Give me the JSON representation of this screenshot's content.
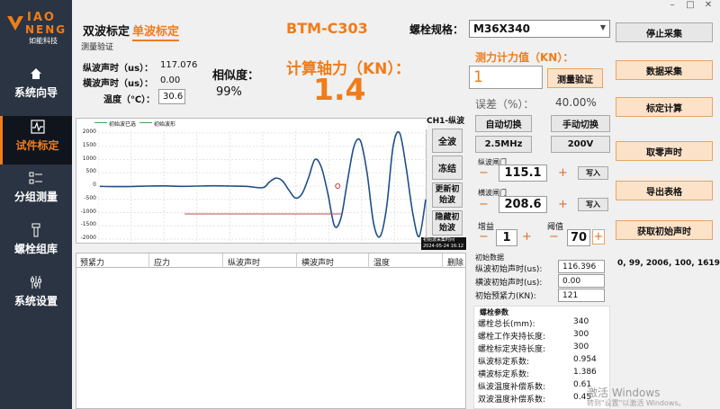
{
  "logo": {
    "line1": "IAO",
    "line2": "NENG",
    "subtitle": "如能科技"
  },
  "nav": [
    {
      "label": "系统向导",
      "icon": "home-icon"
    },
    {
      "label": "试件标定",
      "icon": "waveform-icon",
      "active": true
    },
    {
      "label": "分组测量",
      "icon": "list-icon"
    },
    {
      "label": "螺栓组库",
      "icon": "bolt-icon"
    },
    {
      "label": "系统设置",
      "icon": "settings-icon"
    }
  ],
  "header": {
    "tab_dual": "双波标定",
    "tab_single": "单波标定",
    "device": "BTM-C303",
    "spec_label": "螺栓规格：",
    "spec_value": "M36X340"
  },
  "measure": {
    "section_label": "测量验证",
    "long_label": "纵波声时（us）：",
    "long_value": "117.076",
    "trans_label": "横波声时（us）：",
    "trans_value": "0.00",
    "temp_label": "温度（℃）：",
    "temp_value": "30.6",
    "similarity_label": "相似度：",
    "similarity_value": "99%",
    "axial_label": "计算轴力（KN）：",
    "axial_value": "1.4",
    "force_label": "测力计力值（KN）：",
    "force_value": "1",
    "verify_btn": "测量验证",
    "error_label": "误差（%）：",
    "error_value": "40.00%"
  },
  "chart": {
    "legend_series1": "初始波已选",
    "legend_series2": "初始波形",
    "channel": "CH1-纵波",
    "btn_full": "全波",
    "btn_freeze": "冻结",
    "btn_update": "更新初始波",
    "btn_hide": "隐藏初始波",
    "status_strip": "初始波采集时间",
    "status_date": "2024-05-24 16:12",
    "yticks": [
      "2000",
      "1500",
      "1000",
      "500",
      "0",
      "-500",
      "-1000",
      "-1500",
      "-2000"
    ]
  },
  "chart_data": {
    "type": "line",
    "series": [
      {
        "name": "初始波形"
      }
    ],
    "ylim": [
      -2000,
      2000
    ],
    "yticks": [
      2000,
      1500,
      1000,
      500,
      0,
      -500,
      -1000,
      -1500,
      -2000
    ],
    "x": [
      0,
      0.05,
      0.1,
      0.15,
      0.2,
      0.25,
      0.3,
      0.35,
      0.4,
      0.45,
      0.5,
      0.52,
      0.54,
      0.56,
      0.58,
      0.6,
      0.62,
      0.64,
      0.66,
      0.68,
      0.7,
      0.72,
      0.74,
      0.76,
      0.78,
      0.8,
      0.82,
      0.84,
      0.86,
      0.88,
      0.9,
      0.92,
      0.94,
      0.96,
      0.98,
      1.0
    ],
    "y": [
      -10,
      -20,
      -15,
      0,
      5,
      -10,
      0,
      10,
      0,
      -10,
      -60,
      150,
      300,
      200,
      -150,
      -450,
      -300,
      300,
      1000,
      700,
      -300,
      -1500,
      -1200,
      200,
      1500,
      1700,
      500,
      -1400,
      -1900,
      -800,
      1500,
      2000,
      700,
      -1000,
      -1900,
      -500
    ],
    "marker_x": 0.73,
    "marker_y": 0,
    "hline_y": -1050,
    "hline_x": [
      0.26,
      0.74
    ]
  },
  "controls": {
    "auto_switch": "自动切换",
    "manual_switch": "手动切换",
    "freq": "2.5MHz",
    "voltage": "200V",
    "long_gate_label": "纵波闸门",
    "long_gate_value": "115.1",
    "trans_gate_label": "横波闸门",
    "trans_gate_value": "208.6",
    "write_btn": "写入",
    "gain_label": "增益",
    "gain_value": "1",
    "threshold_label": "阈值",
    "threshold_value": "70",
    "minus": "−",
    "plus": "+"
  },
  "table": {
    "headers": [
      "预紧力",
      "应力",
      "纵波声时",
      "横波声时",
      "温度",
      "删除"
    ]
  },
  "init_data": {
    "title": "初始数据",
    "rows": [
      {
        "label": "纵波初始声时(us):",
        "value": "116.396"
      },
      {
        "label": "横波初始声时(us):",
        "value": "0.00"
      },
      {
        "label": "初始预紧力(KN):",
        "value": "121"
      }
    ]
  },
  "bolt_params": {
    "title": "螺栓参数",
    "rows": [
      {
        "label": "螺栓总长(mm):",
        "value": "340"
      },
      {
        "label": "螺栓工作夹持长度:",
        "value": "300"
      },
      {
        "label": "螺栓标定夹持长度:",
        "value": "300"
      },
      {
        "label": "纵波标定系数:",
        "value": "0.954"
      },
      {
        "label": "横波标定系数:",
        "value": "1.386"
      },
      {
        "label": "纵波温度补偿系数:",
        "value": "0.61"
      },
      {
        "label": "双波温度补偿系数:",
        "value": "0.45"
      }
    ]
  },
  "right_buttons": [
    "停止采集",
    "数据采集",
    "标定计算",
    "取零声时",
    "导出表格",
    "获取初始声时"
  ],
  "readout": "0, 99, 2006, 100, 1619",
  "watermark": {
    "line1": "激活 Windows",
    "line2": "转到\"设置\"以激活 Windows。"
  },
  "colors": {
    "accent": "#f07c1a",
    "sidebar": "#2b3442",
    "button_orange": "#fce2c8"
  }
}
